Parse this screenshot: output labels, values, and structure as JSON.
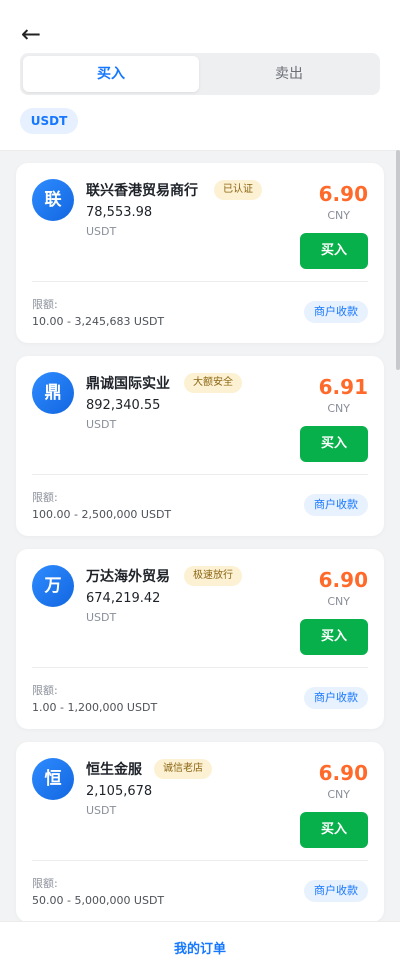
{
  "header": {
    "back_icon": "arrow-left-icon",
    "tabs": {
      "buy": "买入",
      "sell": "卖出"
    },
    "filter_chip": "USDT"
  },
  "colors": {
    "accent": "#1677ff",
    "price": "#ff6a2a",
    "buy_button": "#07b04a",
    "badge_bg": "#fdf1d3"
  },
  "merchants": [
    {
      "avatar": "联",
      "name": "联兴香港贸易商行",
      "badge": "已认证",
      "available": "78,553.98",
      "unit": "USDT",
      "price": "6.90",
      "currency": "CNY",
      "buy_label": "买入",
      "limit_label": "限额:",
      "limit": "10.00 - 3,245,683 USDT",
      "payment": "商户收款"
    },
    {
      "avatar": "鼎",
      "name": "鼎诚国际实业",
      "badge": "大额安全",
      "available": "892,340.55",
      "unit": "USDT",
      "price": "6.91",
      "currency": "CNY",
      "buy_label": "买入",
      "limit_label": "限额:",
      "limit": "100.00 - 2,500,000 USDT",
      "payment": "商户收款"
    },
    {
      "avatar": "万",
      "name": "万达海外贸易",
      "badge": "极速放行",
      "available": "674,219.42",
      "unit": "USDT",
      "price": "6.90",
      "currency": "CNY",
      "buy_label": "买入",
      "limit_label": "限额:",
      "limit": "1.00 - 1,200,000 USDT",
      "payment": "商户收款"
    },
    {
      "avatar": "恒",
      "name": "恒生金服",
      "badge": "诚信老店",
      "available": "2,105,678",
      "unit": "USDT",
      "price": "6.90",
      "currency": "CNY",
      "buy_label": "买入",
      "limit_label": "限额:",
      "limit": "50.00 - 5,000,000 USDT",
      "payment": "商户收款"
    }
  ],
  "footer": {
    "my_orders": "我的订单"
  }
}
